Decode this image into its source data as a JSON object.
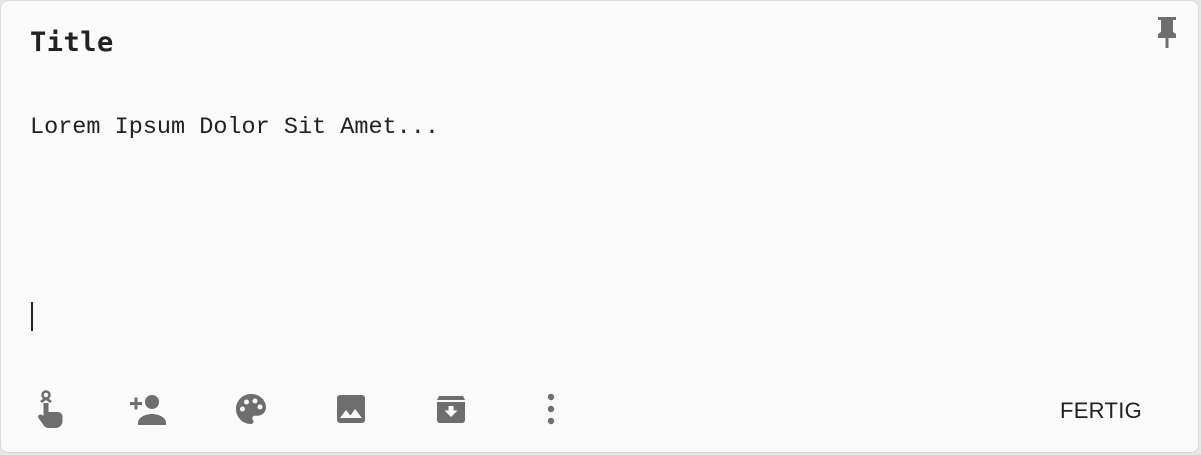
{
  "note": {
    "title": "Title",
    "body": "Lorem Ipsum Dolor Sit Amet..."
  },
  "header": {
    "pin_icon": "pin-icon"
  },
  "toolbar": {
    "icons": [
      "remind-me-icon",
      "collaborator-icon",
      "palette-icon",
      "image-icon",
      "archive-icon",
      "more-vert-icon"
    ],
    "done_label": "FERTIG"
  },
  "colors": {
    "card_background": "#fafafa",
    "icon": "#5f6368",
    "text": "#202124"
  }
}
